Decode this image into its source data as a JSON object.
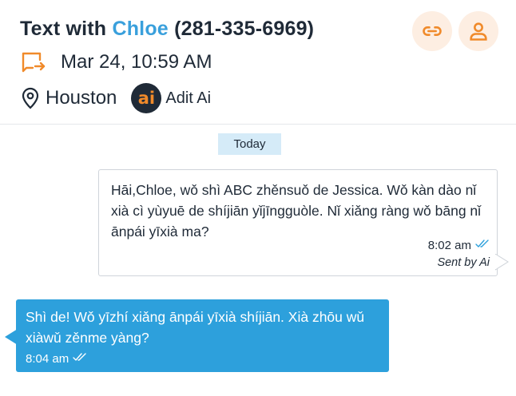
{
  "header": {
    "title_prefix": "Text with",
    "contact_name": "Chloe",
    "contact_phone": "(281-335-6969)",
    "date": "Mar 24, 10:59 AM",
    "location": "Houston",
    "assistant_logo_text": "ai",
    "assistant_name": "Adit Ai"
  },
  "conversation": {
    "day_label": "Today",
    "messages": [
      {
        "direction": "outgoing",
        "text": "Hāi,Chloe, wǒ shì ABC zhěnsuǒ de Jessica. Wǒ kàn dào nǐ xià cì yùyuē de shíjiān yǐjīngguòle. Nǐ xiǎng ràng wǒ bāng nǐ ānpái yīxià ma?",
        "time": "8:02 am",
        "sent_by": "Sent by Ai"
      },
      {
        "direction": "incoming",
        "text": "Shì de! Wǒ yīzhí xiǎng ānpái yīxià shíjiān. Xià zhōu wǔ xiàwǔ zěnme yàng?",
        "time": "8:04 am"
      }
    ]
  },
  "colors": {
    "accent_blue": "#2da0dc",
    "accent_orange": "#f08a2a",
    "text_dark": "#1f2a37"
  },
  "icons": [
    "link-icon",
    "person-icon",
    "chat-forward-icon",
    "location-pin-icon",
    "double-check-icon"
  ]
}
